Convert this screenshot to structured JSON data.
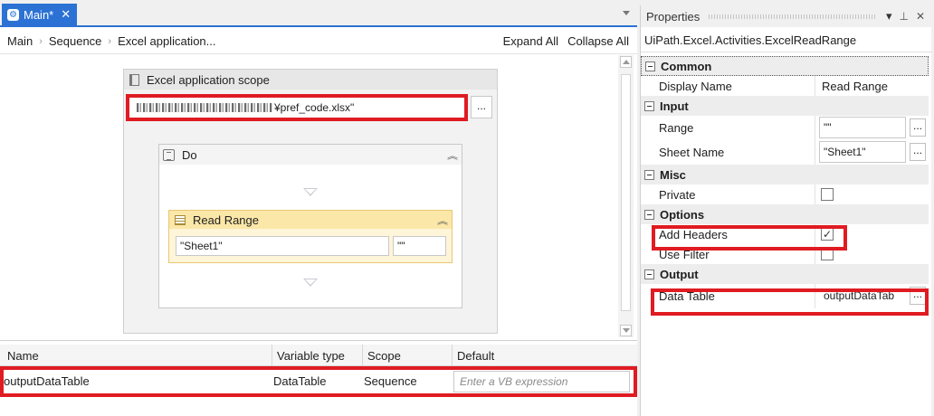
{
  "tab": {
    "label": "Main*",
    "close": "✕"
  },
  "breadcrumb": {
    "items": [
      "Main",
      "Sequence",
      "Excel application..."
    ],
    "expand_all": "Expand All",
    "collapse_all": "Collapse All"
  },
  "scope": {
    "title": "Excel application scope",
    "path_visible": "¥pref_code.xlsx\"",
    "more_button": "..."
  },
  "do": {
    "title": "Do",
    "collapse": "«"
  },
  "read_range": {
    "title": "Read Range",
    "collapse": "«",
    "sheet_value": "\"Sheet1\"",
    "range_value": "\"\""
  },
  "variables": {
    "columns": [
      "Name",
      "Variable type",
      "Scope",
      "Default"
    ],
    "row": {
      "name": "outputDataTable",
      "type": "DataTable",
      "scope": "Sequence",
      "default_placeholder": "Enter a VB expression"
    }
  },
  "properties": {
    "title": "Properties",
    "type_name": "UiPath.Excel.Activities.ExcelReadRange",
    "categories": {
      "common": "Common",
      "input": "Input",
      "misc": "Misc",
      "options": "Options",
      "output": "Output"
    },
    "fields": {
      "display_name": {
        "label": "Display Name",
        "value": "Read Range"
      },
      "range": {
        "label": "Range",
        "value": "\"\""
      },
      "sheet_name": {
        "label": "Sheet Name",
        "value": "\"Sheet1\""
      },
      "private": {
        "label": "Private",
        "checked": false
      },
      "add_headers": {
        "label": "Add Headers",
        "checked": true,
        "mark": "✓"
      },
      "use_filter": {
        "label": "Use Filter",
        "checked": false
      },
      "data_table": {
        "label": "Data Table",
        "value": "outputDataTab"
      }
    },
    "more_button": "...",
    "pin_icon": "pin-icon",
    "close_icon": "close-icon"
  },
  "colors": {
    "accent": "#2b72d4",
    "highlight": "#e01b22",
    "activity_fill": "#fff5d8",
    "activity_header": "#fbe7a8"
  }
}
